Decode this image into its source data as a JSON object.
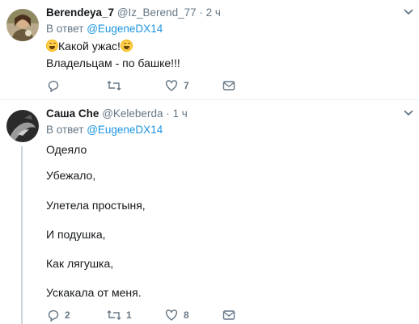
{
  "colors": {
    "link": "#1b95e0",
    "muted": "#657786",
    "text": "#14171a",
    "divider": "#e6ecf0",
    "thread": "#ccd6dd"
  },
  "tweets": [
    {
      "name": "Berendeya_7",
      "handle": "@Iz_Berend_77",
      "dot": "·",
      "time": "2 ч",
      "reply_prefix": "В ответ",
      "reply_mention": "@EugeneDX14",
      "lines": [
        {
          "text": "Какой ужас!",
          "emoji_before": "grinning-squint-emoji",
          "emoji_after": "grinning-squint-emoji"
        },
        {
          "text": "Владельцам - по башке!!!"
        }
      ],
      "actions": {
        "reply_count": "",
        "retweet_count": "",
        "like_count": "7"
      }
    },
    {
      "name": "Саша Che",
      "handle": "@Keleberda",
      "dot": "·",
      "time": "1 ч",
      "reply_prefix": "В ответ",
      "reply_mention": "@EugeneDX14",
      "lines": [
        {
          "text": "Одеяло"
        },
        {
          "text": "Убежало,"
        },
        {
          "text": "Улетела простыня,"
        },
        {
          "text": "И подушка,"
        },
        {
          "text": "Как лягушка,"
        },
        {
          "text": "Ускакала от меня."
        }
      ],
      "actions": {
        "reply_count": "2",
        "retweet_count": "1",
        "like_count": "8"
      }
    }
  ]
}
